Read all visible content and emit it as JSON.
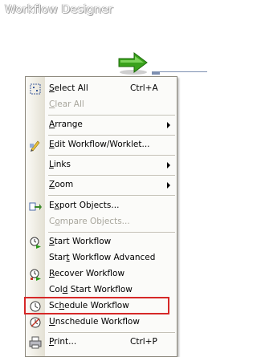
{
  "window": {
    "title": "Workflow Designer"
  },
  "canvas": {
    "start_task_icon": "green-arrow-icon",
    "link_icon": "link-line"
  },
  "menu": {
    "items": [
      {
        "icon": "select-all-icon",
        "pre": "",
        "key": "S",
        "post": "elect All",
        "shortcut": "Ctrl+A",
        "enabled": true
      },
      {
        "icon": "",
        "pre": "",
        "key": "C",
        "post": "lear All",
        "shortcut": "",
        "enabled": false
      },
      {
        "icon": "",
        "pre": "",
        "key": "A",
        "post": "rrange",
        "shortcut": "",
        "enabled": true,
        "submenu": true
      },
      {
        "icon": "edit-workflow-icon",
        "pre": "",
        "key": "E",
        "post": "dit Workflow/Worklet...",
        "shortcut": "",
        "enabled": true
      },
      {
        "icon": "",
        "pre": "",
        "key": "L",
        "post": "inks",
        "shortcut": "",
        "enabled": true,
        "submenu": true
      },
      {
        "icon": "",
        "pre": "",
        "key": "Z",
        "post": "oom",
        "shortcut": "",
        "enabled": true,
        "submenu": true
      },
      {
        "icon": "export-objects-icon",
        "pre": "E",
        "key": "x",
        "post": "port Objects...",
        "shortcut": "",
        "enabled": true
      },
      {
        "icon": "",
        "pre": "C",
        "key": "o",
        "post": "mpare Objects...",
        "shortcut": "",
        "enabled": false
      },
      {
        "icon": "start-workflow-icon",
        "pre": "",
        "key": "S",
        "post": "tart Workflow",
        "shortcut": "",
        "enabled": true
      },
      {
        "icon": "",
        "pre": "Star",
        "key": "t",
        "post": " Workflow Advanced",
        "shortcut": "",
        "enabled": true
      },
      {
        "icon": "recover-workflow-icon",
        "pre": "",
        "key": "R",
        "post": "ecover Workflow",
        "shortcut": "",
        "enabled": true
      },
      {
        "icon": "",
        "pre": "Col",
        "key": "d",
        "post": " Start Workflow",
        "shortcut": "",
        "enabled": true
      },
      {
        "icon": "schedule-workflow-icon",
        "pre": "Sc",
        "key": "h",
        "post": "edule Workflow",
        "shortcut": "",
        "enabled": true,
        "highlighted": true
      },
      {
        "icon": "unschedule-workflow-icon",
        "pre": "",
        "key": "U",
        "post": "nschedule Workflow",
        "shortcut": "",
        "enabled": true
      },
      {
        "icon": "print-icon",
        "pre": "",
        "key": "P",
        "post": "rint...",
        "shortcut": "Ctrl+P",
        "enabled": true
      }
    ]
  }
}
